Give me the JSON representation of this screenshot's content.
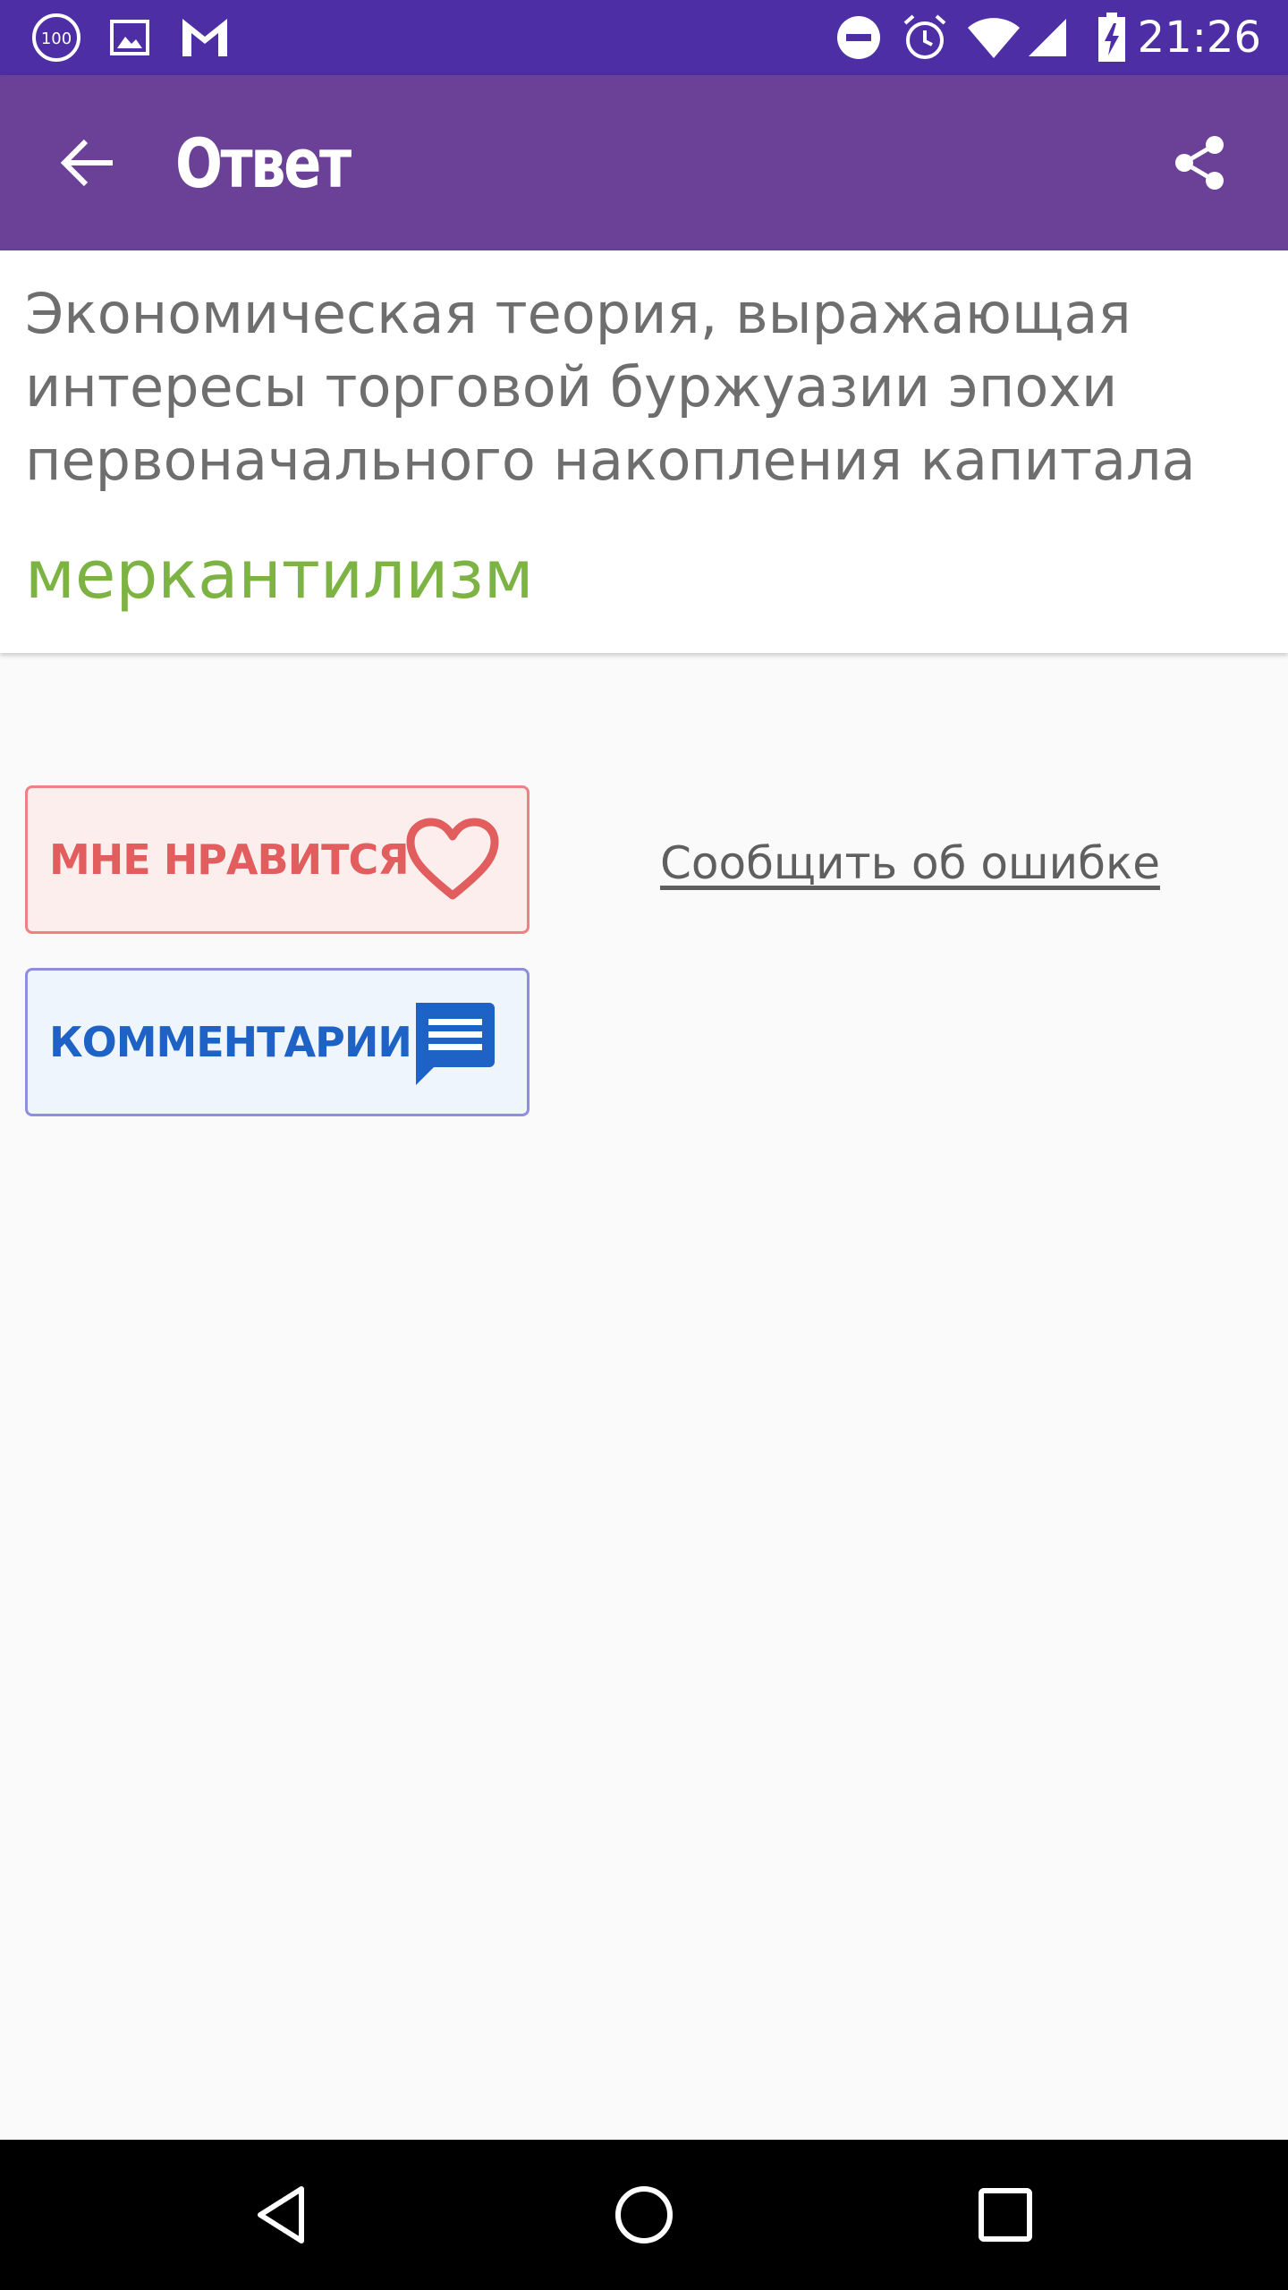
{
  "status_bar": {
    "time": "21:26",
    "battery_saver_badge": "100",
    "icons": [
      "battery-100-icon",
      "image-icon",
      "gmail-icon",
      "do-not-disturb-icon",
      "alarm-icon",
      "wifi-icon",
      "cell-signal-icon",
      "battery-charging-icon"
    ]
  },
  "app_bar": {
    "title": "Ответ",
    "back_icon": "arrow-back-icon",
    "share_icon": "share-icon"
  },
  "card": {
    "question": "Экономическая теория, выражающая интересы торговой буржуазии эпохи первоначального накопления капитала",
    "answer": "меркантилизм"
  },
  "actions": {
    "like_label": "МНЕ НРАВИТСЯ",
    "like_icon": "heart-outline-icon",
    "comments_label": "КОММЕНТАРИИ",
    "comments_icon": "comment-icon",
    "report_label": "Сообщить об ошибке"
  },
  "colors": {
    "status_bar": "#4e2ea5",
    "app_bar": "#6a4197",
    "answer": "#7cb342",
    "like": "#e25d5d",
    "comments": "#1e62c6"
  },
  "nav_bar": {
    "icons": [
      "nav-back-icon",
      "nav-home-icon",
      "nav-recents-icon"
    ]
  }
}
